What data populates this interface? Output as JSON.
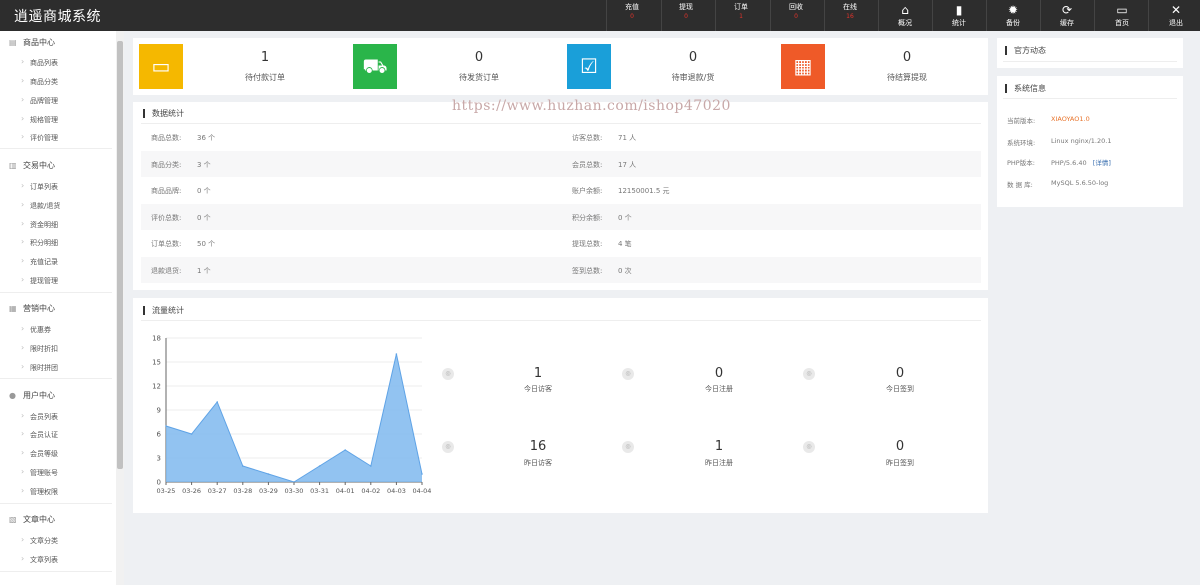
{
  "app": {
    "title": "逍遥商城系统"
  },
  "topbar": {
    "notifications": [
      {
        "label": "充值",
        "count": "0"
      },
      {
        "label": "提现",
        "count": "0"
      },
      {
        "label": "订单",
        "count": "1"
      },
      {
        "label": "回收",
        "count": "0"
      },
      {
        "label": "在线",
        "count": "16"
      }
    ],
    "nav": [
      {
        "label": "概况",
        "icon": "home-icon"
      },
      {
        "label": "统计",
        "icon": "bar-chart-icon"
      },
      {
        "label": "备份",
        "icon": "gear-icon"
      },
      {
        "label": "缓存",
        "icon": "refresh-icon"
      },
      {
        "label": "首页",
        "icon": "monitor-icon"
      },
      {
        "label": "退出",
        "icon": "close-icon"
      }
    ],
    "colors": {
      "bg": "#2d2d2d",
      "badge": "#e0332b"
    }
  },
  "sidebar": {
    "groups": [
      {
        "title": "商品中心",
        "icon": "goods-icon",
        "items": [
          "商品列表",
          "商品分类",
          "品牌管理",
          "规格管理",
          "评价管理"
        ]
      },
      {
        "title": "交易中心",
        "icon": "chart-icon",
        "items": [
          "订单列表",
          "退款/退货",
          "资金明细",
          "积分明细",
          "充值记录",
          "提现管理"
        ]
      },
      {
        "title": "营销中心",
        "icon": "marketing-icon",
        "items": [
          "优惠券",
          "限时折扣",
          "限时拼团"
        ]
      },
      {
        "title": "用户中心",
        "icon": "user-icon",
        "items": [
          "会员列表",
          "会员认证",
          "会员等级",
          "管理账号",
          "管理权限"
        ]
      },
      {
        "title": "文章中心",
        "icon": "article-icon",
        "items": [
          "文章分类",
          "文章列表"
        ]
      }
    ]
  },
  "stats_cards": [
    {
      "value": "1",
      "label": "待付款订单",
      "color": "#f5b800",
      "icon": "wallet-icon"
    },
    {
      "value": "0",
      "label": "待发货订单",
      "color": "#2ab54a",
      "icon": "truck-icon"
    },
    {
      "value": "0",
      "label": "待审退款/货",
      "color": "#1a9fd9",
      "icon": "box-check-icon"
    },
    {
      "value": "0",
      "label": "待结算提现",
      "color": "#ef5a28",
      "icon": "calculator-icon"
    }
  ],
  "watermark": "https://www.huzhan.com/ishop47020",
  "data_stats": {
    "title": "数据统计",
    "left": [
      {
        "label": "商品总数:",
        "value": "36 个"
      },
      {
        "label": "商品分类:",
        "value": "3 个"
      },
      {
        "label": "商品品牌:",
        "value": "0 个"
      },
      {
        "label": "评价总数:",
        "value": "0 个"
      },
      {
        "label": "订单总数:",
        "value": "50 个"
      },
      {
        "label": "退款退货:",
        "value": "1 个"
      }
    ],
    "right": [
      {
        "label": "访客总数:",
        "value": "71 人"
      },
      {
        "label": "会员总数:",
        "value": "17 人"
      },
      {
        "label": "账户余额:",
        "value": "12150001.5 元"
      },
      {
        "label": "积分余额:",
        "value": "0 个"
      },
      {
        "label": "提现总数:",
        "value": "4 笔"
      },
      {
        "label": "签到总数:",
        "value": "0 次"
      }
    ]
  },
  "traffic": {
    "title": "流量统计",
    "stats": [
      {
        "value": "1",
        "label": "今日访客"
      },
      {
        "value": "0",
        "label": "今日注册"
      },
      {
        "value": "0",
        "label": "今日签到"
      },
      {
        "value": "16",
        "label": "昨日访客"
      },
      {
        "value": "1",
        "label": "昨日注册"
      },
      {
        "value": "0",
        "label": "昨日签到"
      }
    ]
  },
  "chart_data": {
    "type": "area",
    "x": [
      "03-25",
      "03-26",
      "03-27",
      "03-28",
      "03-29",
      "03-30",
      "03-31",
      "04-01",
      "04-02",
      "04-03",
      "04-04"
    ],
    "series": [
      {
        "values": [
          7,
          6,
          10,
          2,
          1,
          0,
          2,
          4,
          2,
          16,
          1
        ]
      }
    ],
    "yticks": [
      "0",
      "3",
      "6",
      "9",
      "12",
      "15",
      "18"
    ],
    "ylim": [
      0,
      18
    ],
    "grid": true,
    "colors": {
      "fill": "#7fb8ef",
      "line": "#5fa3e6"
    }
  },
  "right_panels": {
    "news_title": "官方动态",
    "sysinfo_title": "系统信息",
    "sysinfo": [
      {
        "label": "当前版本:",
        "value": "XIAOYAO1.0",
        "accent": "#e8742c"
      },
      {
        "label": "系统环境:",
        "value": "Linux nginx/1.20.1"
      },
      {
        "label": "PHP版本:",
        "value": "PHP/5.6.40",
        "link": "[详情]"
      },
      {
        "label": "数 据 库:",
        "value": "MySQL 5.6.50-log"
      }
    ]
  }
}
